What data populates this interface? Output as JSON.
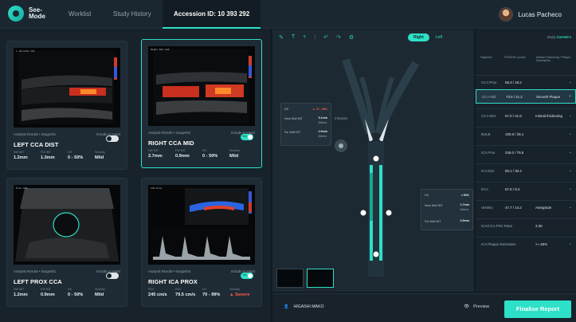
{
  "app": {
    "logo_line1": "See-",
    "logo_line2": "Mode"
  },
  "nav": {
    "worklist": "Worklist",
    "study_history": "Study History",
    "accession": "Accession ID: 10 393 292"
  },
  "user": {
    "name": "Lucas Pacheco"
  },
  "cards": [
    {
      "title": "LEFT CCA DIST",
      "result": "Analysis Results • Image001",
      "include": "Include in report",
      "included": false,
      "metrics": [
        {
          "h": "NW IMT",
          "v": "1.2mm"
        },
        {
          "h": "FW IMT",
          "v": "1.3mm"
        },
        {
          "h": "DS",
          "v": "0 - 50%"
        },
        {
          "h": "Severity",
          "v": "Mild"
        }
      ],
      "overlay": "L  Carotid CCA"
    },
    {
      "title": "RIGHT CCA MID",
      "result": "Analysis Results • Image002",
      "include": "Include in report",
      "included": true,
      "toggle_label": "Yes",
      "metrics": [
        {
          "h": "NW IMT",
          "v": "2.7mm"
        },
        {
          "h": "FW IMT",
          "v": "0.9mm"
        },
        {
          "h": "DS",
          "v": "0 - 50%"
        },
        {
          "h": "Severity",
          "v": "Mild"
        }
      ],
      "overlay": "Right  Mid CCA"
    },
    {
      "title": "LEFT PROX CCA",
      "result": "Analysis Results • Image001",
      "include": "Include in report",
      "included": false,
      "metrics": [
        {
          "h": "NW IMT",
          "v": "1.2mm"
        },
        {
          "h": "FW IMT",
          "v": "0.9mm"
        },
        {
          "h": "DS",
          "v": "0 - 50%"
        },
        {
          "h": "Severity",
          "v": "Mild"
        }
      ],
      "overlay": "Prox CCA"
    },
    {
      "title": "RIGHT ICA PROX",
      "result": "Analysis Results • Image004",
      "include": "Include in report",
      "included": true,
      "toggle_label": "Yes",
      "metrics": [
        {
          "h": "PSV",
          "v": "245 cm/s"
        },
        {
          "h": "EDV",
          "v": "79.5 cm/s"
        },
        {
          "h": "DS",
          "v": "70 - 99%"
        },
        {
          "h": "Severity",
          "v": "▲ Severe"
        }
      ],
      "overlay": "ICA Prox"
    }
  ],
  "center": {
    "side_right": "Right",
    "side_left": "Left",
    "popup1": {
      "label": "DS",
      "ds": "▲ 70 - 99%",
      "nw_label": "Near Wall IMT",
      "nw": "5.1mm",
      "nw_sub": "Athero.",
      "fw_label": "Far Wall IMT",
      "fw": "2.6mm",
      "fw_sub": "Athero."
    },
    "popup2": {
      "label": "DS",
      "ds": "< 50%",
      "nw_label": "Near Wall IMT",
      "nw": "2.7mm",
      "nw_sub": "Athero.",
      "fw_label": "Far Wall IMT",
      "fw": "0.9mm"
    },
    "stenosis_label": "STENOSIS"
  },
  "table": {
    "study_label": "Study",
    "study_value": "Current ▾",
    "headers": {
      "c1": "Segment",
      "c2": "PSV/EDV (cm/s)",
      "c3": "Intimal Thickening / Plaque Description"
    },
    "rows": [
      {
        "seg": "CCA Prox",
        "val": "68.3 / 19.2",
        "desc": ""
      },
      {
        "seg": "CCA Mid",
        "val": "73.5 / 21.2",
        "desc": "Smooth Plaque",
        "hl": true
      },
      {
        "seg": "CCA Dist",
        "val": "67.0 / 21.8",
        "desc": "Intimal thickening"
      },
      {
        "seg": "BULB",
        "val": "100.8 / 25.1",
        "desc": ""
      },
      {
        "seg": "ICA Prox",
        "val": "245.0 / 79.5",
        "desc": ""
      },
      {
        "seg": "ICA Dist",
        "val": "80.1 / 30.4",
        "desc": ""
      },
      {
        "seg": "ECA",
        "val": "67.8 / 8.4",
        "desc": ""
      },
      {
        "seg": "Vertebr.",
        "val": "47.7 / 14.2",
        "desc": "Antegrade"
      },
      {
        "seg": "ICA/CCA PSV Ratio",
        "val": "",
        "desc": "3.35"
      },
      {
        "seg": "ICA Plaque Estimation",
        "val": "",
        "desc": ">= 50%"
      }
    ]
  },
  "bottom": {
    "patient": "HIGASHI MAKO",
    "preview": "Preview",
    "finalise": "Finalise Report"
  },
  "colors": {
    "accent": "#2de0c8",
    "severe": "#ff5a4e",
    "bg": "#131c24"
  }
}
